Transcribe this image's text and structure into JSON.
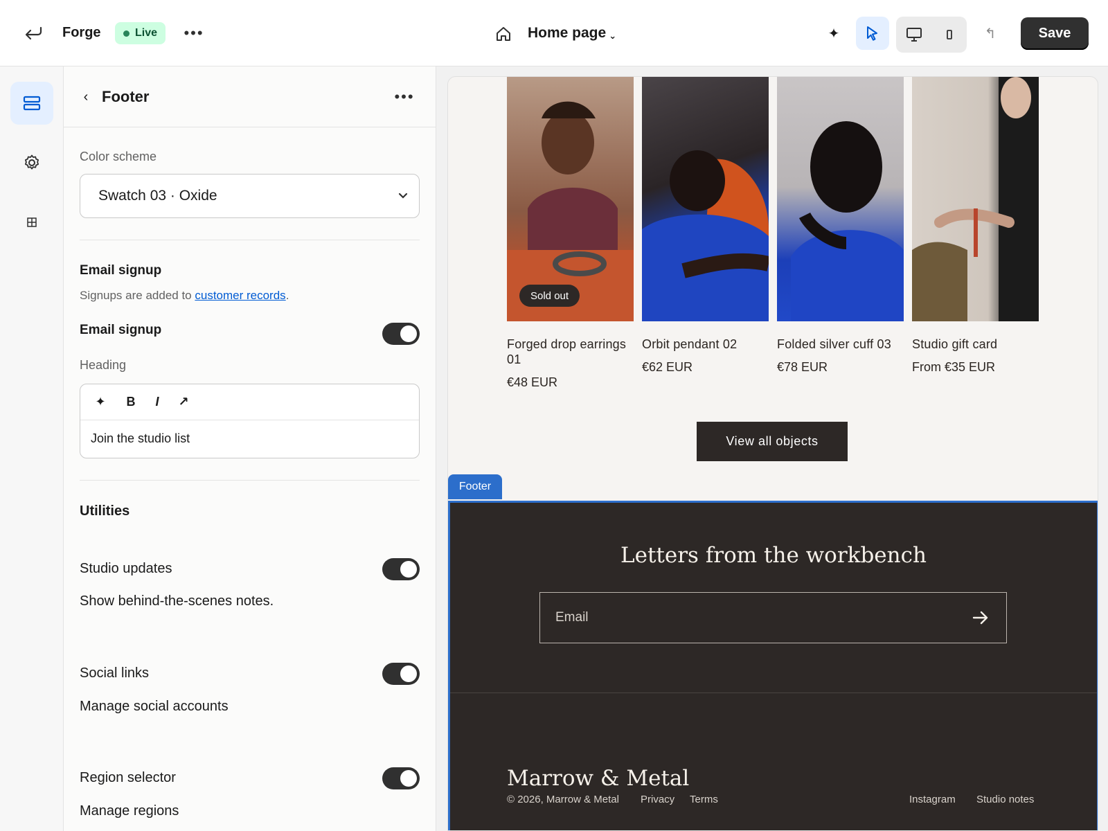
{
  "topbar": {
    "store_name": "Forge",
    "status": "Live",
    "more": "•••",
    "page_name": "Home page",
    "page_chevron": "⌄",
    "save_label": "Save",
    "colors": {
      "live_bg": "#cdfee1",
      "live_text": "#0c5132",
      "select_bg": "#e4efff"
    }
  },
  "rail": {
    "items": [
      {
        "name": "sections",
        "icon": "sections-icon",
        "active": true
      },
      {
        "name": "theme-settings",
        "icon": "gear-icon",
        "active": false
      },
      {
        "name": "apps",
        "icon": "apps-icon",
        "active": false
      }
    ]
  },
  "panel": {
    "title": "Footer",
    "more": "•••",
    "color_scheme": {
      "label": "Color scheme",
      "value": "Swatch 03 · Oxide"
    },
    "email_signup": {
      "section_title": "Email signup",
      "helper_prefix": "Signups are added to ",
      "helper_link": "customer records",
      "helper_suffix": ".",
      "toggle_label": "Email signup",
      "toggle_on": true,
      "heading_label": "Heading",
      "heading_value": "Join the studio list",
      "tools": {
        "ai": "✦",
        "bold": "B",
        "italic": "I",
        "link": "↗"
      }
    },
    "utilities": {
      "title": "Utilities",
      "rows": [
        {
          "label": "Studio updates",
          "desc": "Show behind-the-scenes notes.",
          "on": true
        },
        {
          "label": "Social links",
          "desc": "Manage social accounts",
          "on": true
        },
        {
          "label": "Region selector",
          "desc": "Manage regions",
          "on": true
        }
      ]
    }
  },
  "preview": {
    "products": [
      {
        "name": "Forged drop earrings 01",
        "price": "€48 EUR",
        "badge": "Sold out"
      },
      {
        "name": "Orbit pendant 02",
        "price": "€62 EUR"
      },
      {
        "name": "Folded silver cuff 03",
        "price": "€78 EUR"
      },
      {
        "name": "Studio gift card",
        "price": "From €35 EUR"
      }
    ],
    "view_all": "View all objects",
    "footer_tag": "Footer",
    "footer": {
      "heading": "Letters from the workbench",
      "email_placeholder": "Email",
      "brand": "Marrow & Metal",
      "copyright": "© 2026, Marrow & Metal",
      "policy_links": [
        "Privacy",
        "Terms"
      ],
      "social_links": [
        "Instagram",
        "Studio notes"
      ],
      "colors": {
        "bg": "#2d2826",
        "selection": "#2c6ecb"
      }
    }
  }
}
